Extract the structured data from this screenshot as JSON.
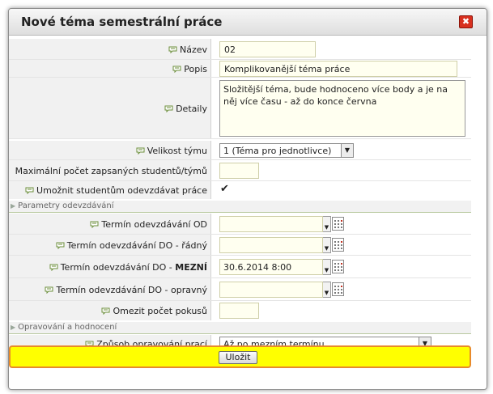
{
  "dialog": {
    "title": "Nové téma semestrální práce",
    "close_label": "✖"
  },
  "fields": {
    "nazev": {
      "label": "Název",
      "value": "02"
    },
    "popis": {
      "label": "Popis",
      "value": "Komplikovanější téma práce"
    },
    "detaily": {
      "label": "Detaily",
      "value": "Složitější téma, bude hodnoceno více body a je na něj více času - až do konce června"
    },
    "velikost": {
      "label": "Velikost týmu",
      "value": "1 (Téma pro jednotlivce)"
    },
    "max_studentu": {
      "label": "Maximální počet zapsaných studentů/týmů",
      "value": ""
    },
    "umoznit": {
      "label": "Umožnit studentům odevzdávat práce",
      "checked": "✔"
    }
  },
  "sections": {
    "parametry": "Parametry odevzdávání",
    "opravovani": "Opravování a hodnocení"
  },
  "deadlines": {
    "od": {
      "label": "Termín odevzdávání OD",
      "value": ""
    },
    "do_radny": {
      "label": "Termín odevzdávání DO - řádný",
      "value": ""
    },
    "do_mezni": {
      "label_prefix": "Termín odevzdávání DO - ",
      "label_bold": "MEZNÍ",
      "value": "30.6.2014 8:00"
    },
    "do_opravny": {
      "label": "Termín odevzdávání DO - opravný",
      "value": ""
    }
  },
  "omezit": {
    "label": "Omezit počet pokusů",
    "value": ""
  },
  "zpusob": {
    "label": "Způsob opravování prací",
    "value": "Až po mezním termínu"
  },
  "save": {
    "label": "Uložit"
  },
  "colors": {
    "highlight": "#ffff00",
    "highlight_border": "#e88a2b",
    "close": "#d8301f"
  }
}
